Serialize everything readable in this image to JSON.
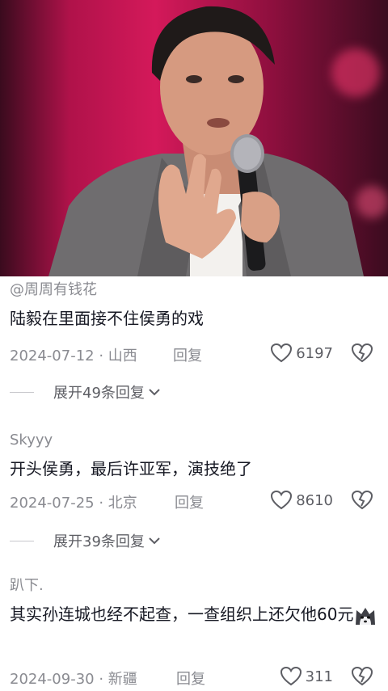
{
  "video": {
    "description_icon": "video-frame"
  },
  "comments": [
    {
      "username": "@周周有钱花",
      "text": "陆毅在里面接不住侯勇的戏",
      "date": "2024-07-12 · 山西",
      "reply_label": "回复",
      "likes": "6197",
      "expand_label": "展开49条回复"
    },
    {
      "username": "Skyyy",
      "text": "开头侯勇，最后许亚军，演技绝了",
      "date": "2024-07-25 · 北京",
      "reply_label": "回复",
      "likes": "8610",
      "expand_label": "展开39条回复"
    },
    {
      "username": "趴下.",
      "text": "其实孙连城也经不起查，一查组织上还欠他60元",
      "date": "2024-09-30 · 新疆",
      "reply_label": "回复",
      "likes": "311",
      "emoji": "husky-emoji"
    }
  ],
  "icons": {
    "like": "heart-icon",
    "dislike": "broken-heart-icon",
    "expand": "chevron-down-icon"
  }
}
